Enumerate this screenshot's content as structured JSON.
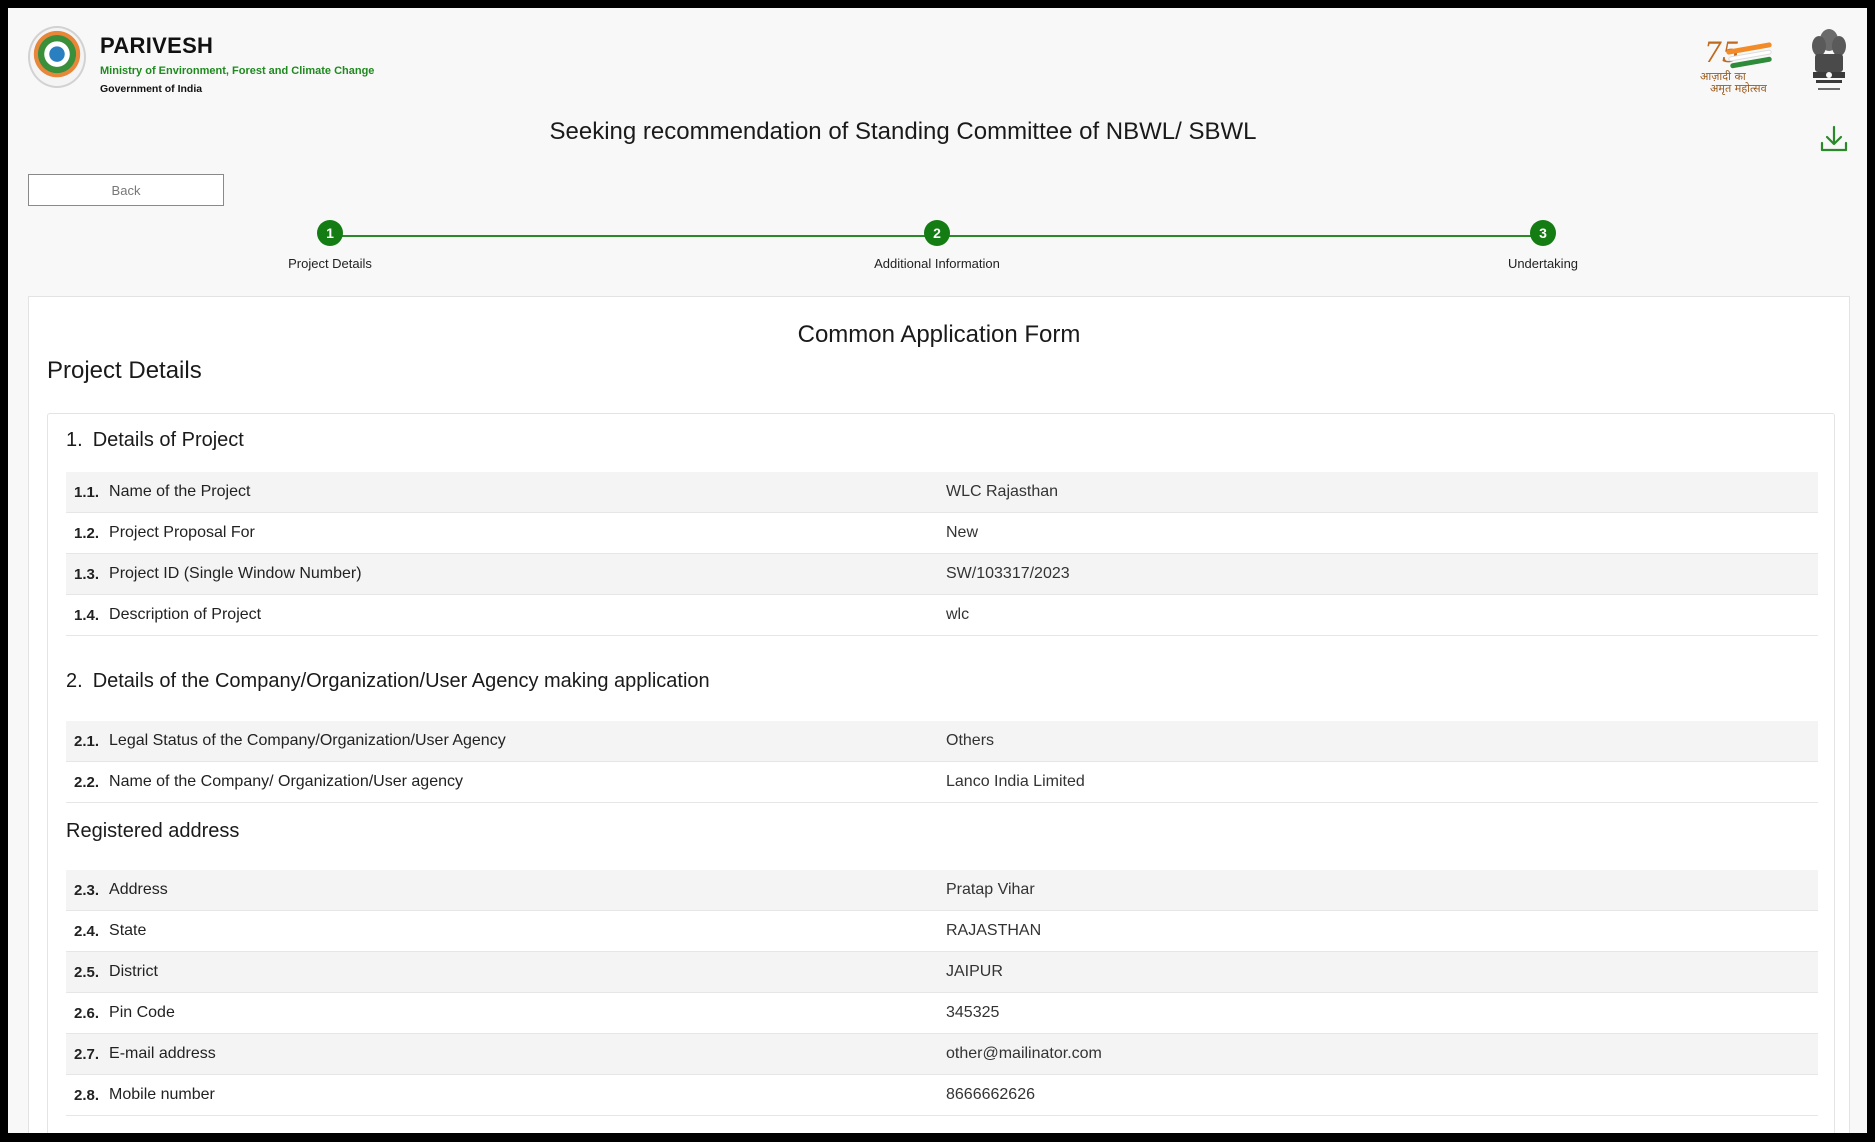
{
  "header": {
    "brand_title": "PARIVESH",
    "brand_subtitle": "Ministry of Environment, Forest and Climate Change",
    "brand_gov": "Government of India",
    "azadi_number": "75",
    "azadi_line1": "आज़ादी का",
    "azadi_line2": "अमृत महोत्सव"
  },
  "page": {
    "title": "Seeking recommendation of Standing Committee of NBWL/ SBWL",
    "back_label": "Back"
  },
  "stepper": {
    "steps": [
      {
        "number": "1",
        "label": "Project Details"
      },
      {
        "number": "2",
        "label": "Additional Information"
      },
      {
        "number": "3",
        "label": "Undertaking"
      }
    ]
  },
  "form": {
    "title": "Common Application Form",
    "section_title": "Project Details",
    "section1": {
      "number": "1.",
      "title": "Details of Project",
      "rows": [
        {
          "idx": "1.1.",
          "label": "Name of the Project",
          "value": "WLC Rajasthan"
        },
        {
          "idx": "1.2.",
          "label": "Project Proposal For",
          "value": "New"
        },
        {
          "idx": "1.3.",
          "label": "Project ID (Single Window Number)",
          "value": "SW/103317/2023"
        },
        {
          "idx": "1.4.",
          "label": "Description of Project",
          "value": "wlc"
        }
      ]
    },
    "section2": {
      "number": "2.",
      "title": "Details of the Company/Organization/User Agency making application",
      "rows": [
        {
          "idx": "2.1.",
          "label": "Legal Status of the Company/Organization/User Agency",
          "value": "Others"
        },
        {
          "idx": "2.2.",
          "label": "Name of the Company/ Organization/User agency",
          "value": "Lanco India Limited"
        }
      ]
    },
    "registered_address": {
      "title": "Registered address",
      "rows": [
        {
          "idx": "2.3.",
          "label": "Address",
          "value": "Pratap Vihar"
        },
        {
          "idx": "2.4.",
          "label": "State",
          "value": "RAJASTHAN"
        },
        {
          "idx": "2.5.",
          "label": "District",
          "value": "JAIPUR"
        },
        {
          "idx": "2.6.",
          "label": "Pin Code",
          "value": "345325"
        },
        {
          "idx": "2.7.",
          "label": "E-mail address",
          "value": "other@mailinator.com"
        },
        {
          "idx": "2.8.",
          "label": "Mobile number",
          "value": "8666662626"
        }
      ]
    }
  },
  "colors": {
    "accent_green": "#137c13",
    "subtitle_green": "#1f8a1f",
    "row_shade": "#f4f4f4"
  },
  "icons": {
    "download": "download-icon",
    "logo": "parivesh-logo-icon",
    "emblem": "national-emblem-icon"
  }
}
